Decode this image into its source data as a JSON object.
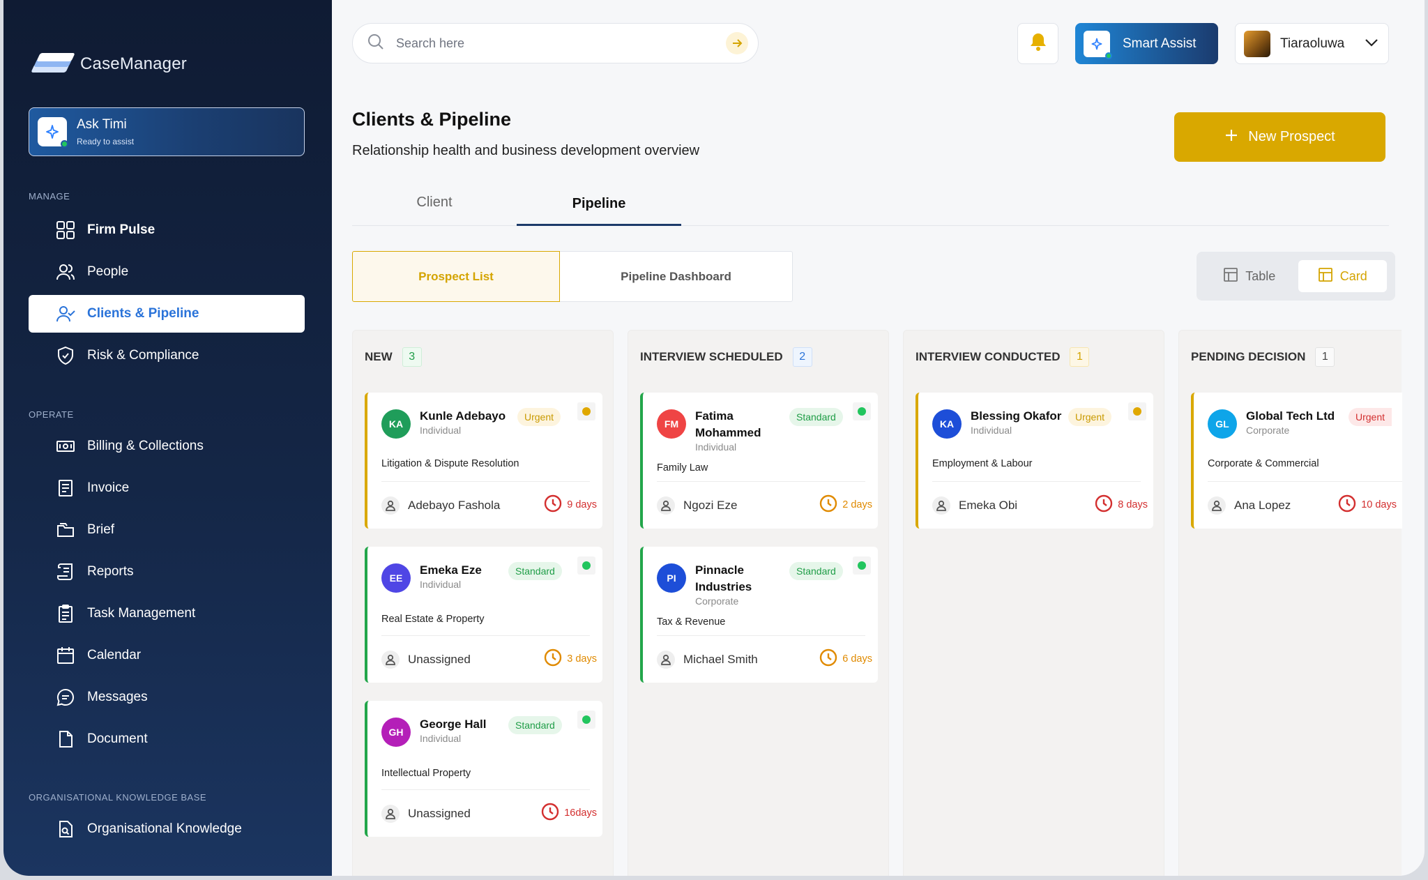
{
  "app": {
    "name": "CaseManager"
  },
  "ask": {
    "title": "Ask Timi",
    "subtitle": "Ready to assist"
  },
  "sidebar": {
    "sections": [
      {
        "label": "MANAGE"
      },
      {
        "label": "OPERATE"
      },
      {
        "label": "ORGANISATIONAL KNOWLEDGE BASE"
      }
    ],
    "items": [
      {
        "label": "Firm Pulse"
      },
      {
        "label": "People"
      },
      {
        "label": "Clients & Pipeline"
      },
      {
        "label": "Risk & Compliance"
      },
      {
        "label": "Billing & Collections"
      },
      {
        "label": "Invoice"
      },
      {
        "label": "Brief"
      },
      {
        "label": "Reports"
      },
      {
        "label": "Task Management"
      },
      {
        "label": "Calendar"
      },
      {
        "label": "Messages"
      },
      {
        "label": "Document"
      },
      {
        "label": "Organisational Knowledge"
      }
    ]
  },
  "search": {
    "placeholder": "Search here"
  },
  "header": {
    "smart_assist": "Smart Assist",
    "user_name": "Tiaraoluwa"
  },
  "page": {
    "title": "Clients & Pipeline",
    "subtitle": "Relationship health and business development overview",
    "new_prospect": "New Prospect"
  },
  "tabs": [
    {
      "label": "Client"
    },
    {
      "label": "Pipeline"
    }
  ],
  "subtabs": [
    {
      "label": "Prospect List"
    },
    {
      "label": "Pipeline Dashboard"
    }
  ],
  "view": {
    "table": "Table",
    "card": "Card"
  },
  "colors": {
    "accent": "#d9a800",
    "brand": "#2a73d9",
    "urgent": "#d9a800",
    "standard": "#22a64a"
  },
  "board": {
    "columns": [
      {
        "title": "NEW",
        "count": "3",
        "cards": [
          {
            "initials": "KA",
            "name": "Kunle Adebayo",
            "type": "Individual",
            "priority": "Urgent",
            "practice": "Litigation & Dispute Resolution",
            "assignee": "Adebayo Fashola",
            "days": "9 days"
          },
          {
            "initials": "EE",
            "name": "Emeka Eze",
            "type": "Individual",
            "priority": "Standard",
            "practice": "Real Estate & Property",
            "assignee": "Unassigned",
            "days": "3 days"
          },
          {
            "initials": "GH",
            "name": "George Hall",
            "type": "Individual",
            "priority": "Standard",
            "practice": "Intellectual Property",
            "assignee": "Unassigned",
            "days": "16days"
          }
        ]
      },
      {
        "title": "INTERVIEW SCHEDULED",
        "count": "2",
        "cards": [
          {
            "initials": "FM",
            "name": "Fatima Mohammed",
            "type": "Individual",
            "priority": "Standard",
            "practice": "Family Law",
            "assignee": "Ngozi Eze",
            "days": "2 days"
          },
          {
            "initials": "PI",
            "name": "Pinnacle Industries",
            "type": "Corporate",
            "priority": "Standard",
            "practice": "Tax & Revenue",
            "assignee": "Michael Smith",
            "days": "6 days"
          }
        ]
      },
      {
        "title": "INTERVIEW CONDUCTED",
        "count": "1",
        "cards": [
          {
            "initials": "KA",
            "name": "Blessing Okafor",
            "type": "Individual",
            "priority": "Urgent",
            "practice": "Employment & Labour",
            "assignee": "Emeka Obi",
            "days": "8 days"
          }
        ]
      },
      {
        "title": "PENDING DECISION",
        "count": "1",
        "cards": [
          {
            "initials": "GL",
            "name": "Global Tech Ltd",
            "type": "Corporate",
            "priority": "Urgent",
            "practice": "Corporate & Commercial",
            "assignee": "Ana Lopez",
            "days": "10 days"
          }
        ]
      }
    ]
  }
}
